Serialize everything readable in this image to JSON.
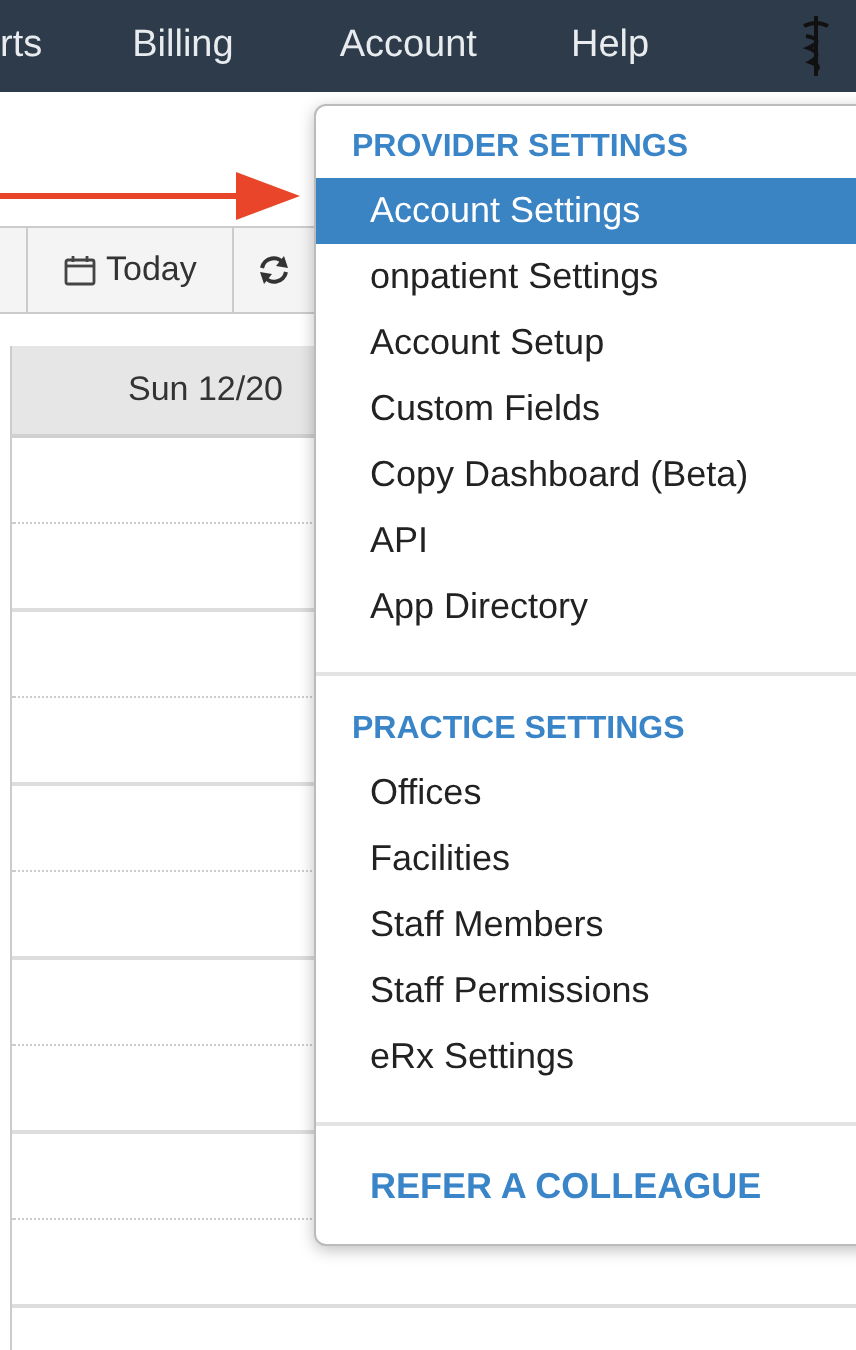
{
  "nav": {
    "items": [
      "rts",
      "Billing",
      "Account",
      "Help"
    ]
  },
  "toolbar": {
    "today_button": "Today"
  },
  "calendar": {
    "day_header": "Sun 12/20"
  },
  "menu": {
    "sections": [
      {
        "header": "PROVIDER SETTINGS",
        "items": [
          {
            "label": "Account Settings",
            "selected": true
          },
          {
            "label": "onpatient Settings",
            "selected": false
          },
          {
            "label": "Account Setup",
            "selected": false
          },
          {
            "label": "Custom Fields",
            "selected": false
          },
          {
            "label": "Copy Dashboard (Beta)",
            "selected": false
          },
          {
            "label": "API",
            "selected": false
          },
          {
            "label": "App Directory",
            "selected": false
          }
        ]
      },
      {
        "header": "PRACTICE SETTINGS",
        "items": [
          {
            "label": "Offices",
            "selected": false
          },
          {
            "label": "Facilities",
            "selected": false
          },
          {
            "label": "Staff Members",
            "selected": false
          },
          {
            "label": "Staff Permissions",
            "selected": false
          },
          {
            "label": "eRx Settings",
            "selected": false
          }
        ]
      }
    ],
    "footer_link": "REFER A COLLEAGUE"
  }
}
